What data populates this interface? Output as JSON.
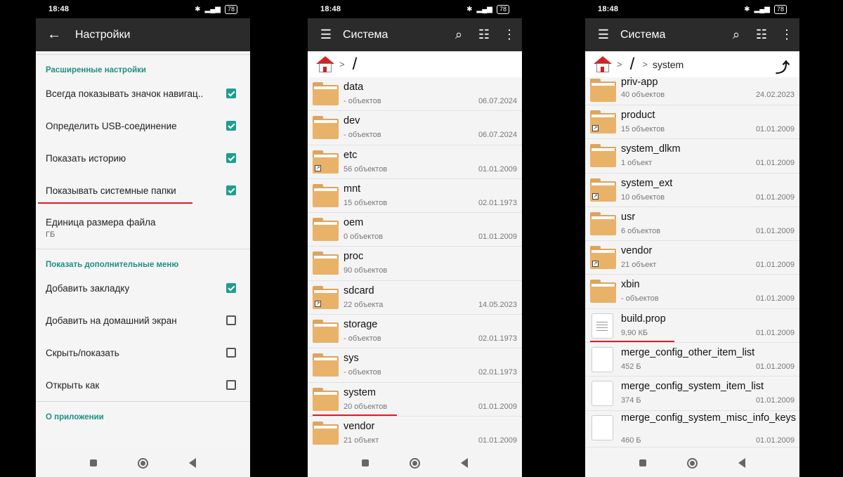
{
  "status": {
    "time": "18:48",
    "battery": "78"
  },
  "settings": {
    "title": "Настройки",
    "section1": "Расширенные настройки",
    "row1": "Всегда показывать значок навигац..",
    "row2": "Определить USB-соединение",
    "row3": "Показать историю",
    "row4": "Показывать системные папки",
    "size_title": "Единица размера файла",
    "size_value": "ГБ",
    "section2": "Показать дополнительные меню",
    "row5": "Добавить закладку",
    "row6": "Добавить на домашний экран",
    "row7": "Скрыть/показать",
    "row8": "Открыть как",
    "section3": "О приложении"
  },
  "screen2": {
    "title": "Система",
    "crumb": "/",
    "files": [
      {
        "name": "data",
        "sub": "- объектов",
        "date": "06.07.2024"
      },
      {
        "name": "dev",
        "sub": "- объектов",
        "date": "06.07.2024"
      },
      {
        "name": "etc",
        "sub": "56 объектов",
        "date": "01.01.2009"
      },
      {
        "name": "mnt",
        "sub": "15 объектов",
        "date": "02.01.1973"
      },
      {
        "name": "oem",
        "sub": "0 объектов",
        "date": "01.01.2009"
      },
      {
        "name": "proc",
        "sub": "90 объектов",
        "date": ""
      },
      {
        "name": "sdcard",
        "sub": "22 объекта",
        "date": "14.05.2023"
      },
      {
        "name": "storage",
        "sub": "- объектов",
        "date": "02.01.1973"
      },
      {
        "name": "sys",
        "sub": "- объектов",
        "date": "02.01.1973"
      },
      {
        "name": "system",
        "sub": "20 объектов",
        "date": "01.01.2009"
      },
      {
        "name": "vendor",
        "sub": "21 объект",
        "date": "01.01.2009"
      }
    ]
  },
  "screen3": {
    "title": "Система",
    "crumb_root": "/",
    "crumb_dir": "system",
    "files": [
      {
        "name": "priv-app",
        "sub": "40 объектов",
        "date": "24.02.2023"
      },
      {
        "name": "product",
        "sub": "15 объектов",
        "date": "01.01.2009"
      },
      {
        "name": "system_dlkm",
        "sub": "1 объект",
        "date": "01.01.2009"
      },
      {
        "name": "system_ext",
        "sub": "10 объектов",
        "date": "01.01.2009"
      },
      {
        "name": "usr",
        "sub": "6 объектов",
        "date": "01.01.2009"
      },
      {
        "name": "vendor",
        "sub": "21 объект",
        "date": "01.01.2009"
      },
      {
        "name": "xbin",
        "sub": "- объектов",
        "date": "01.01.2009"
      },
      {
        "name": "build.prop",
        "sub": "9,90 КБ",
        "date": "01.01.2009"
      },
      {
        "name": "merge_config_other_item_list",
        "sub": "452 Б",
        "date": "01.01.2009"
      },
      {
        "name": "merge_config_system_item_list",
        "sub": "374 Б",
        "date": "01.01.2009"
      },
      {
        "name": "merge_config_system_misc_info_keys",
        "sub": "460 Б",
        "date": "01.01.2009"
      }
    ]
  }
}
